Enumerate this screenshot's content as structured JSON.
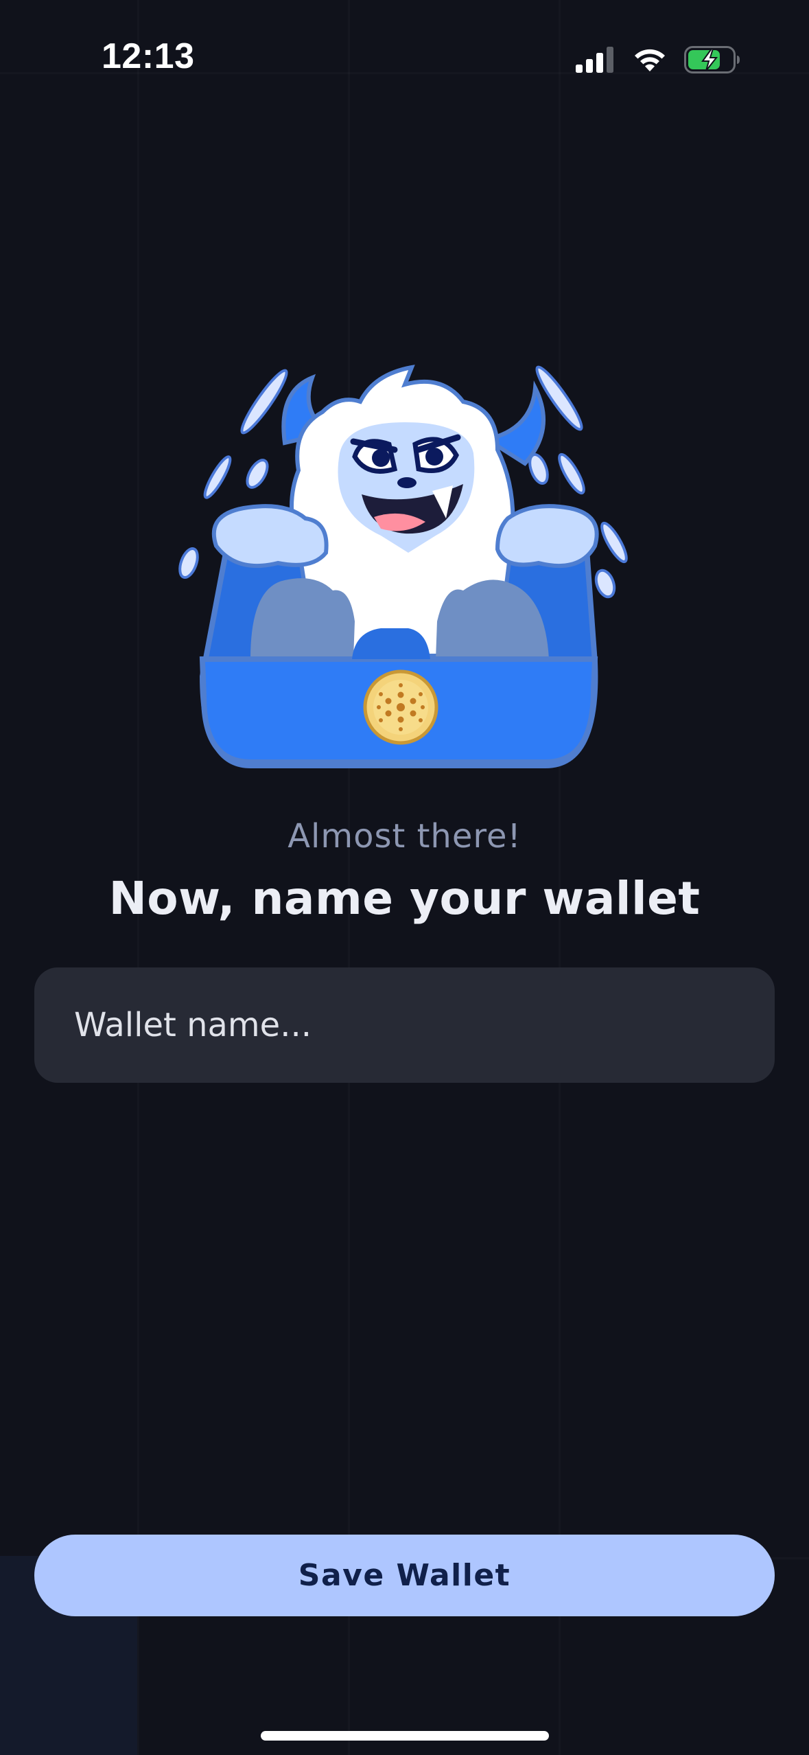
{
  "status_bar": {
    "time": "12:13",
    "icons": [
      "cellular-signal-icon",
      "wifi-icon",
      "battery-charging-icon"
    ]
  },
  "mascot": {
    "icon": "yeti-wallet-mascot-icon",
    "coin_icon": "cardano-coin-icon"
  },
  "onboarding": {
    "subtitle": "Almost there!",
    "title": "Now, name your wallet"
  },
  "wallet_name_input": {
    "value": "",
    "placeholder": "Wallet name..."
  },
  "save_button": {
    "label": "Save Wallet"
  },
  "colors": {
    "background": "#10121b",
    "input_background": "#272a35",
    "button_background": "#aec6ff",
    "button_text": "#10204a",
    "accent_blue": "#2f7cf6"
  }
}
